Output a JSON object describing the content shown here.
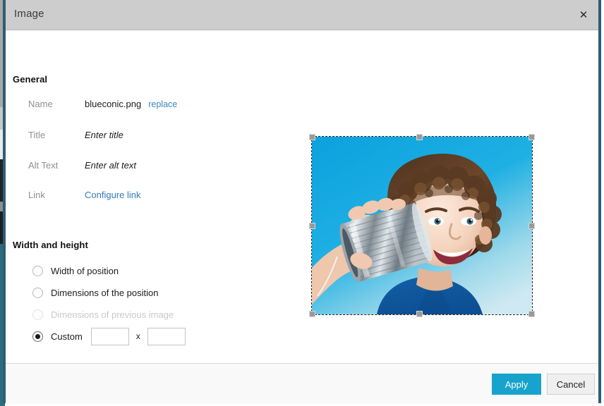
{
  "dialog": {
    "title": "Image",
    "close_icon": "close-icon"
  },
  "general": {
    "heading": "General",
    "fields": [
      {
        "label": "Name",
        "value": "blueconic.png",
        "action_label": "replace"
      },
      {
        "label": "Title",
        "placeholder": "Enter title"
      },
      {
        "label": "Alt Text",
        "placeholder": "Enter alt text"
      },
      {
        "label": "Link",
        "link_label": "Configure link"
      }
    ]
  },
  "width_and_height": {
    "heading": "Width and height",
    "options": [
      {
        "label": "Width of position",
        "selected": false,
        "disabled": false
      },
      {
        "label": "Dimensions of the position",
        "selected": false,
        "disabled": false
      },
      {
        "label": "Dimensions of previous image",
        "selected": false,
        "disabled": true
      },
      {
        "label": "Custom",
        "selected": true,
        "disabled": false
      }
    ],
    "custom": {
      "width_value": "",
      "height_value": "",
      "separator": "x"
    }
  },
  "preview": {
    "alt": "Boy smiling while holding a tin can to his ear against a blue background",
    "selected": true
  },
  "footer": {
    "apply_label": "Apply",
    "cancel_label": "Cancel"
  },
  "colors": {
    "titlebar": "#cdcdcd",
    "accent": "#18a3cd",
    "link": "#2f7cb8",
    "dialog_border": "#2c5f72",
    "label": "#8f8f8f",
    "footer_bg": "#f9f9f9"
  }
}
